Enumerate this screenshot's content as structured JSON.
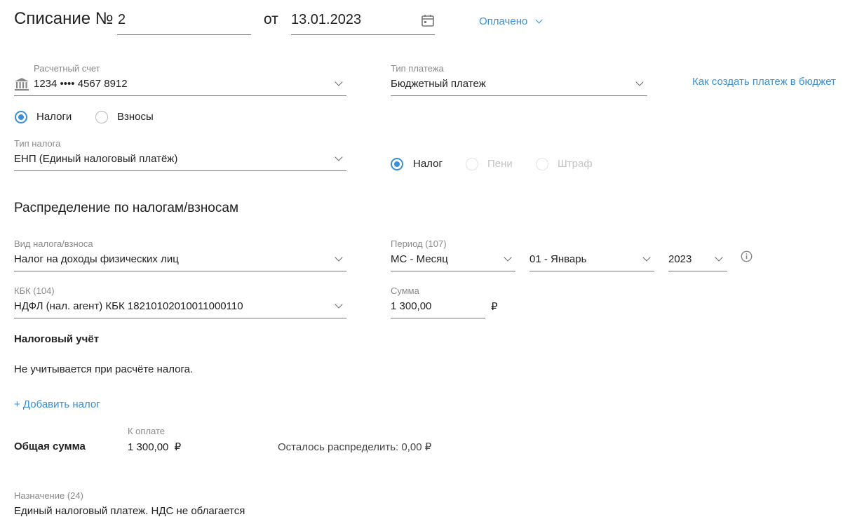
{
  "header": {
    "title": "Списание №",
    "number": "2",
    "from_label": "от",
    "date": "13.01.2023",
    "status": "Оплачено"
  },
  "account": {
    "label": "Расчетный счет",
    "value": "1234 •••• 4567 8912"
  },
  "payment_type": {
    "label": "Тип платежа",
    "value": "Бюджетный платеж"
  },
  "help_link": "Как создать платеж в бюджет",
  "category_radios": {
    "taxes": "Налоги",
    "contributions": "Взносы",
    "selected": "taxes"
  },
  "tax_type": {
    "label": "Тип налога",
    "value": "ЕНП (Единый налоговый платёж)"
  },
  "payment_kind_radios": {
    "tax": "Налог",
    "penalty": "Пени",
    "fine": "Штраф",
    "selected": "tax"
  },
  "distribution": {
    "title": "Распределение по налогам/взносам",
    "tax_kind": {
      "label": "Вид налога/взноса",
      "value": "Налог на доходы физических лиц"
    },
    "period": {
      "label": "Период (107)",
      "type": "МС - Месяц",
      "month": "01 - Январь",
      "year": "2023"
    },
    "kbk": {
      "label": "КБК (104)",
      "value": "НДФЛ (нал. агент) КБК 18210102010011000110"
    },
    "amount": {
      "label": "Сумма",
      "value": "1 300,00",
      "currency": "₽"
    },
    "tax_accounting_title": "Налоговый учёт",
    "tax_accounting_text": "Не учитывается при расчёте налога.",
    "add_tax": "+ Добавить налог"
  },
  "total": {
    "label": "Общая сумма",
    "to_pay_label": "К оплате",
    "to_pay_value": "1 300,00",
    "currency": "₽",
    "remaining": "Осталось распределить: 0,00 ₽"
  },
  "purpose": {
    "label": "Назначение (24)",
    "value": "Единый налоговый платеж. НДС не облагается"
  },
  "colors": {
    "accent": "#3b8fd4",
    "label": "#8a8a8a",
    "text": "#222222"
  }
}
